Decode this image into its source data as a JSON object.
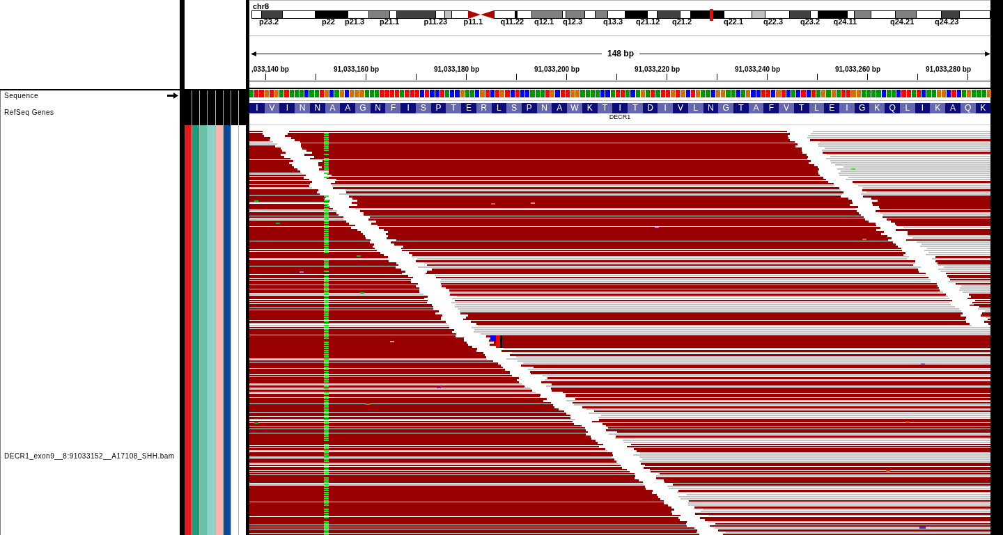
{
  "ideogram": {
    "chromosome": "chr8",
    "cytobands": [
      "p23.2",
      "p22",
      "p21.3",
      "p21.1",
      "p11.23",
      "p11.1",
      "q11.22",
      "q12.1",
      "q12.3",
      "q13.3",
      "q21.12",
      "q21.2",
      "q22.1",
      "q22.3",
      "q23.2",
      "q24.11",
      "q24.21",
      "q24.23"
    ]
  },
  "ruler": {
    "span": "148 bp",
    "ticks": [
      ",033,140 bp",
      "91,033,160 bp",
      "91,033,180 bp",
      "91,033,200 bp",
      "91,033,220 bp",
      "91,033,240 bp",
      "91,033,260 bp",
      "91,033,280 bp"
    ]
  },
  "tracks": [
    {
      "kind": "sequence",
      "name": "Sequence",
      "forward_strand": true
    },
    {
      "kind": "genes",
      "name": "RefSeq Genes"
    },
    {
      "kind": "alignment",
      "name": "DECR1_exon9__8:91033152__A17108_SHH.bam"
    }
  ],
  "attributes": [
    {
      "color": "#e31a1c"
    },
    {
      "color": "#1b9e77"
    },
    {
      "color": "#66c2a5"
    },
    {
      "color": "#8dd3c7"
    },
    {
      "color": "#fbb4ae"
    },
    {
      "color": "#0b4a99"
    },
    {
      "color": "#ffffff"
    },
    {
      "color": "#ffffff"
    }
  ],
  "sequence": {
    "bases": [
      {
        "color": "#009600"
      },
      {
        "color": "#ff0000"
      },
      {
        "color": "#ff0000"
      },
      {
        "color": "#d17105"
      },
      {
        "color": "#ff0000"
      },
      {
        "color": "#d17105"
      },
      {
        "color": "#009600"
      },
      {
        "color": "#ff0000"
      },
      {
        "color": "#009600"
      },
      {
        "color": "#009600"
      },
      {
        "color": "#009600"
      },
      {
        "color": "#0000ff"
      },
      {
        "color": "#009600"
      },
      {
        "color": "#009600"
      },
      {
        "color": "#ff0000"
      },
      {
        "color": "#d17105"
      },
      {
        "color": "#0000ff"
      },
      {
        "color": "#009600"
      },
      {
        "color": "#d17105"
      },
      {
        "color": "#0000ff"
      },
      {
        "color": "#d17105"
      },
      {
        "color": "#d17105"
      },
      {
        "color": "#d17105"
      },
      {
        "color": "#009600"
      },
      {
        "color": "#009600"
      },
      {
        "color": "#009600"
      },
      {
        "color": "#ff0000"
      },
      {
        "color": "#ff0000"
      },
      {
        "color": "#ff0000"
      },
      {
        "color": "#ff0000"
      },
      {
        "color": "#009600"
      },
      {
        "color": "#ff0000"
      },
      {
        "color": "#ff0000"
      },
      {
        "color": "#ff0000"
      },
      {
        "color": "#0000ff"
      },
      {
        "color": "#ff0000"
      },
      {
        "color": "#0000ff"
      },
      {
        "color": "#0000ff"
      },
      {
        "color": "#ff0000"
      },
      {
        "color": "#009600"
      },
      {
        "color": "#0000ff"
      },
      {
        "color": "#0000ff"
      },
      {
        "color": "#d17105"
      },
      {
        "color": "#009600"
      },
      {
        "color": "#009600"
      },
      {
        "color": "#0000ff"
      },
      {
        "color": "#d17105"
      },
      {
        "color": "#ff0000"
      },
      {
        "color": "#0000ff"
      },
      {
        "color": "#ff0000"
      },
      {
        "color": "#d17105"
      },
      {
        "color": "#ff0000"
      },
      {
        "color": "#0000ff"
      },
      {
        "color": "#ff0000"
      },
      {
        "color": "#0000ff"
      },
      {
        "color": "#0000ff"
      },
      {
        "color": "#009600"
      },
      {
        "color": "#009600"
      },
      {
        "color": "#009600"
      },
      {
        "color": "#ff0000"
      },
      {
        "color": "#d17105"
      },
      {
        "color": "#0000ff"
      },
      {
        "color": "#ff0000"
      },
      {
        "color": "#ff0000"
      },
      {
        "color": "#d17105"
      },
      {
        "color": "#d17105"
      },
      {
        "color": "#009600"
      },
      {
        "color": "#009600"
      },
      {
        "color": "#009600"
      },
      {
        "color": "#009600"
      },
      {
        "color": "#0000ff"
      },
      {
        "color": "#0000ff"
      },
      {
        "color": "#009600"
      },
      {
        "color": "#ff0000"
      },
      {
        "color": "#ff0000"
      },
      {
        "color": "#009600"
      },
      {
        "color": "#0000ff"
      },
      {
        "color": "#009600"
      },
      {
        "color": "#d17105"
      },
      {
        "color": "#009600"
      },
      {
        "color": "#ff0000"
      },
      {
        "color": "#009600"
      },
      {
        "color": "#ff0000"
      },
      {
        "color": "#ff0000"
      },
      {
        "color": "#d17105"
      },
      {
        "color": "#ff0000"
      },
      {
        "color": "#d17105"
      },
      {
        "color": "#0000ff"
      },
      {
        "color": "#ff0000"
      },
      {
        "color": "#d17105"
      },
      {
        "color": "#009600"
      },
      {
        "color": "#009600"
      },
      {
        "color": "#0000ff"
      },
      {
        "color": "#d17105"
      },
      {
        "color": "#d17105"
      },
      {
        "color": "#009600"
      },
      {
        "color": "#009600"
      },
      {
        "color": "#0000ff"
      },
      {
        "color": "#009600"
      },
      {
        "color": "#d17105"
      },
      {
        "color": "#0000ff"
      },
      {
        "color": "#0000ff"
      },
      {
        "color": "#ff0000"
      },
      {
        "color": "#ff0000"
      },
      {
        "color": "#0000ff"
      },
      {
        "color": "#d17105"
      },
      {
        "color": "#ff0000"
      },
      {
        "color": "#0000ff"
      },
      {
        "color": "#009600"
      },
      {
        "color": "#0000ff"
      },
      {
        "color": "#ff0000"
      },
      {
        "color": "#0000ff"
      },
      {
        "color": "#ff0000"
      },
      {
        "color": "#009600"
      },
      {
        "color": "#d17105"
      },
      {
        "color": "#009600"
      },
      {
        "color": "#d17105"
      },
      {
        "color": "#009600"
      },
      {
        "color": "#ff0000"
      },
      {
        "color": "#ff0000"
      },
      {
        "color": "#d17105"
      },
      {
        "color": "#d17105"
      },
      {
        "color": "#009600"
      },
      {
        "color": "#009600"
      },
      {
        "color": "#009600"
      },
      {
        "color": "#009600"
      },
      {
        "color": "#0000ff"
      },
      {
        "color": "#009600"
      },
      {
        "color": "#009600"
      },
      {
        "color": "#0000ff"
      },
      {
        "color": "#ff0000"
      },
      {
        "color": "#ff0000"
      },
      {
        "color": "#009600"
      },
      {
        "color": "#ff0000"
      },
      {
        "color": "#0000ff"
      },
      {
        "color": "#009600"
      },
      {
        "color": "#009600"
      },
      {
        "color": "#d17105"
      },
      {
        "color": "#d17105"
      },
      {
        "color": "#0000ff"
      },
      {
        "color": "#ff0000"
      },
      {
        "color": "#0000ff"
      },
      {
        "color": "#009600"
      },
      {
        "color": "#d17105"
      },
      {
        "color": "#009600"
      },
      {
        "color": "#009600"
      },
      {
        "color": "#009600"
      },
      {
        "color": "#d17105"
      }
    ]
  },
  "gene": {
    "name": "DECR1",
    "amino_acids": [
      "I",
      "V",
      "I",
      "N",
      "N",
      "A",
      "A",
      "G",
      "N",
      "F",
      "I",
      "S",
      "P",
      "T",
      "E",
      "R",
      "L",
      "S",
      "P",
      "N",
      "A",
      "W",
      "K",
      "T",
      "I",
      "T",
      "D",
      "I",
      "V",
      "L",
      "N",
      "G",
      "T",
      "A",
      "F",
      "V",
      "T",
      "L",
      "E",
      "I",
      "G",
      "K",
      "Q",
      "L",
      "I",
      "K",
      "A",
      "Q",
      "K"
    ]
  }
}
